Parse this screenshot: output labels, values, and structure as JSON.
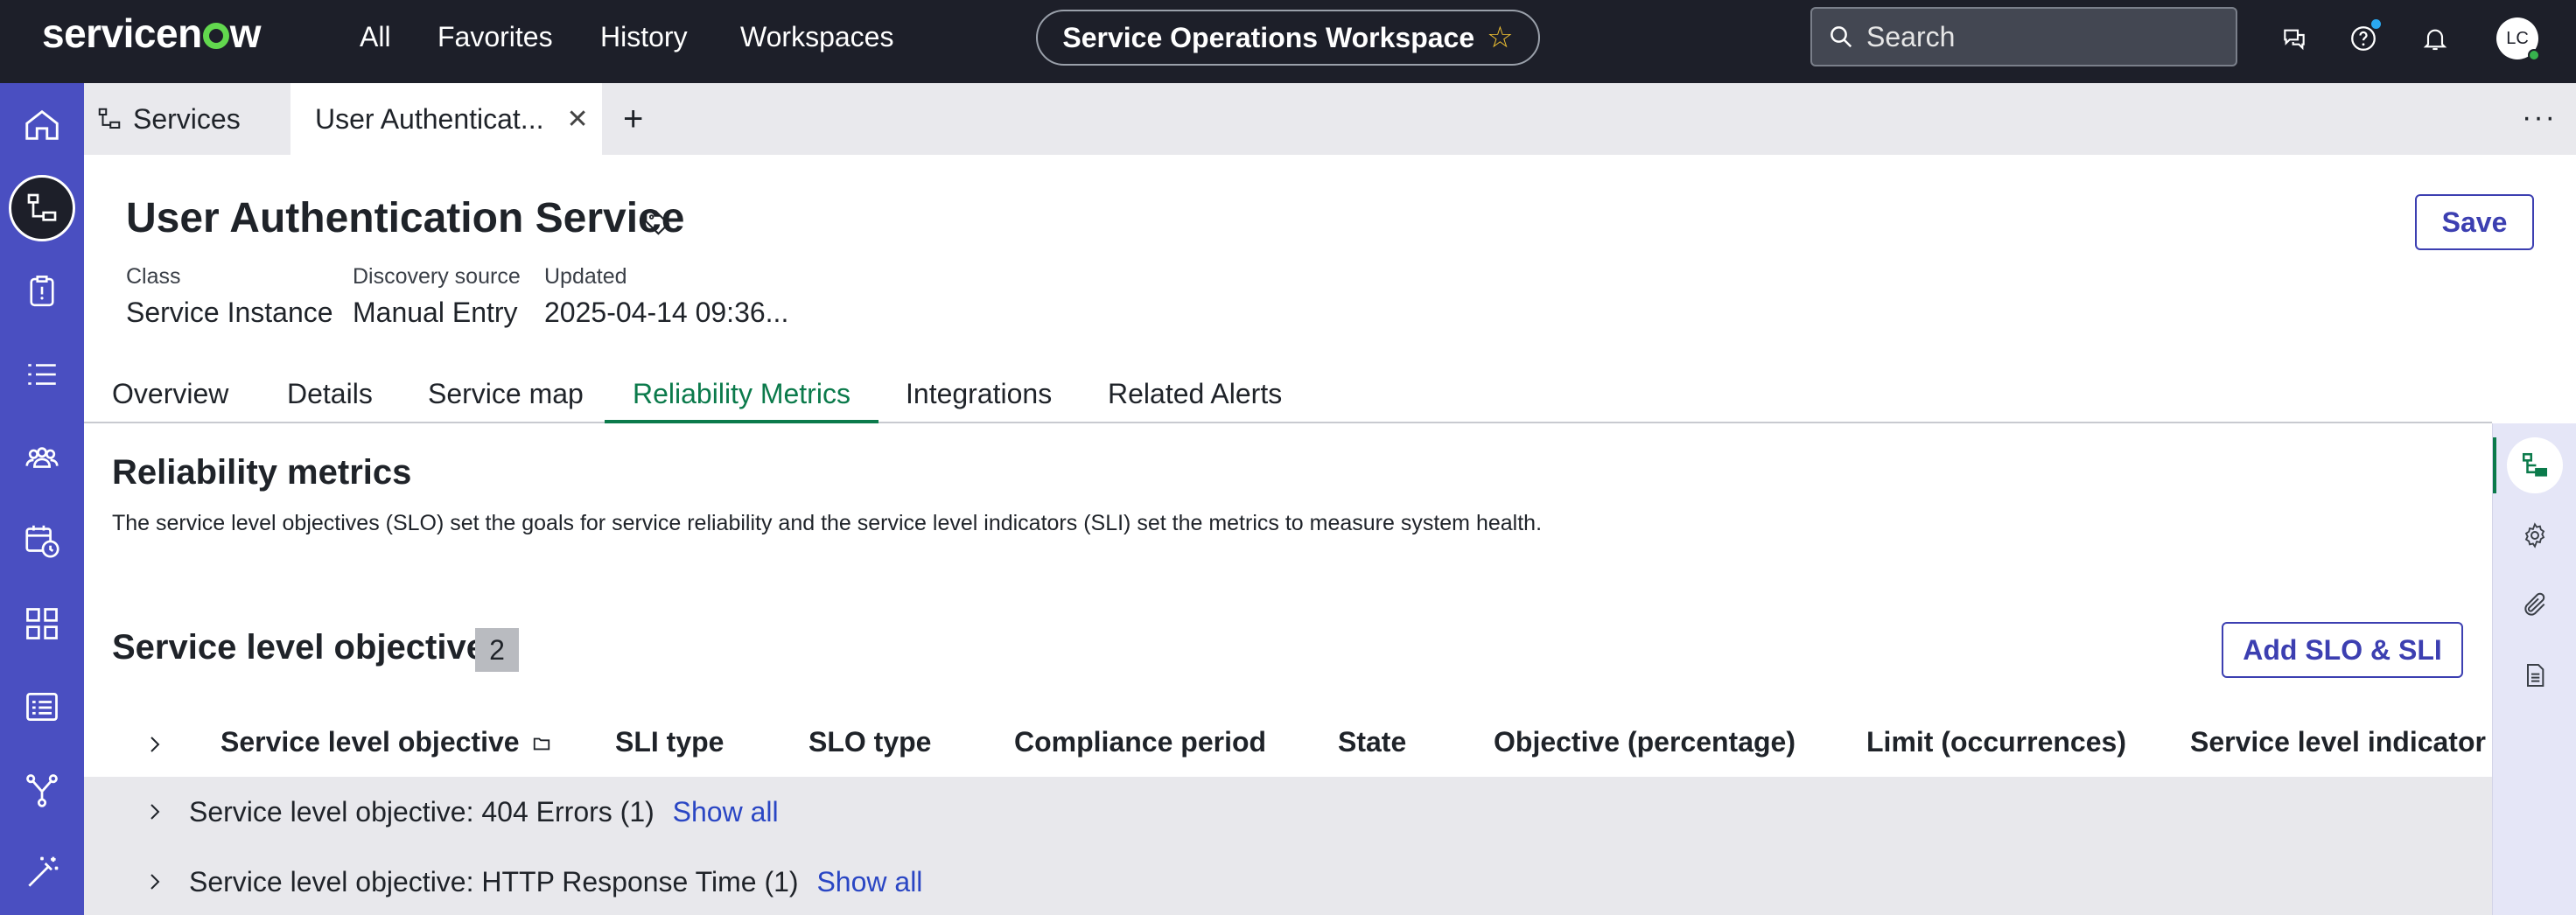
{
  "topnav": {
    "logo": "servicenow",
    "links": [
      "All",
      "Favorites",
      "History",
      "Workspaces"
    ],
    "workspace_label": "Service Operations Workspace",
    "search_placeholder": "Search",
    "avatar_initials": "LC"
  },
  "tabs": [
    {
      "label": "Services"
    },
    {
      "label": "User Authenticat..."
    }
  ],
  "record": {
    "title": "User Authentication Service",
    "save_label": "Save",
    "meta": [
      {
        "label": "Class",
        "value": "Service Instance"
      },
      {
        "label": "Discovery source",
        "value": "Manual Entry"
      },
      {
        "label": "Updated",
        "value": "2025-04-14 09:36..."
      }
    ]
  },
  "section_tabs": [
    "Overview",
    "Details",
    "Service map",
    "Reliability Metrics",
    "Integrations",
    "Related Alerts"
  ],
  "active_section_tab": "Reliability Metrics",
  "reliability": {
    "title": "Reliability metrics",
    "description": "The service level objectives (SLO) set the goals for service reliability and the service level indicators (SLI) set the metrics to measure system health.",
    "slo_title": "Service level objectives",
    "slo_count": "2",
    "add_button": "Add SLO & SLI",
    "columns": [
      "Service level objective",
      "SLI type",
      "SLO type",
      "Compliance period",
      "State",
      "Objective (percentage)",
      "Limit (occurrences)",
      "Service level indicator"
    ],
    "groups": [
      {
        "label": "Service level objective: 404 Errors (1)",
        "link": "Show all"
      },
      {
        "label": "Service level objective: HTTP Response Time (1)",
        "link": "Show all"
      }
    ]
  },
  "colors": {
    "nav_bg": "#1d1f29",
    "rail_bg": "#4a4fc1",
    "accent_green": "#0b7a4b",
    "button_blue": "#3c3fb1",
    "link_blue": "#2a46c4"
  }
}
